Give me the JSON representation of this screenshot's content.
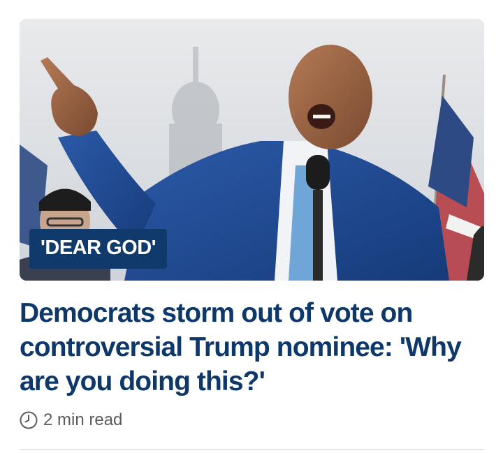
{
  "article": {
    "kicker": "'DEAR GOD'",
    "headline": "Democrats storm out of vote on controversial Trump nominee: 'Why are you doing this?'",
    "read_time": "2 min read",
    "image_icon": "news-photo-icon",
    "time_icon": "clock-icon"
  },
  "colors": {
    "headline": "#0d3869",
    "kicker_bg": "#0f3a6b",
    "meta_text": "#5c5c5c"
  }
}
